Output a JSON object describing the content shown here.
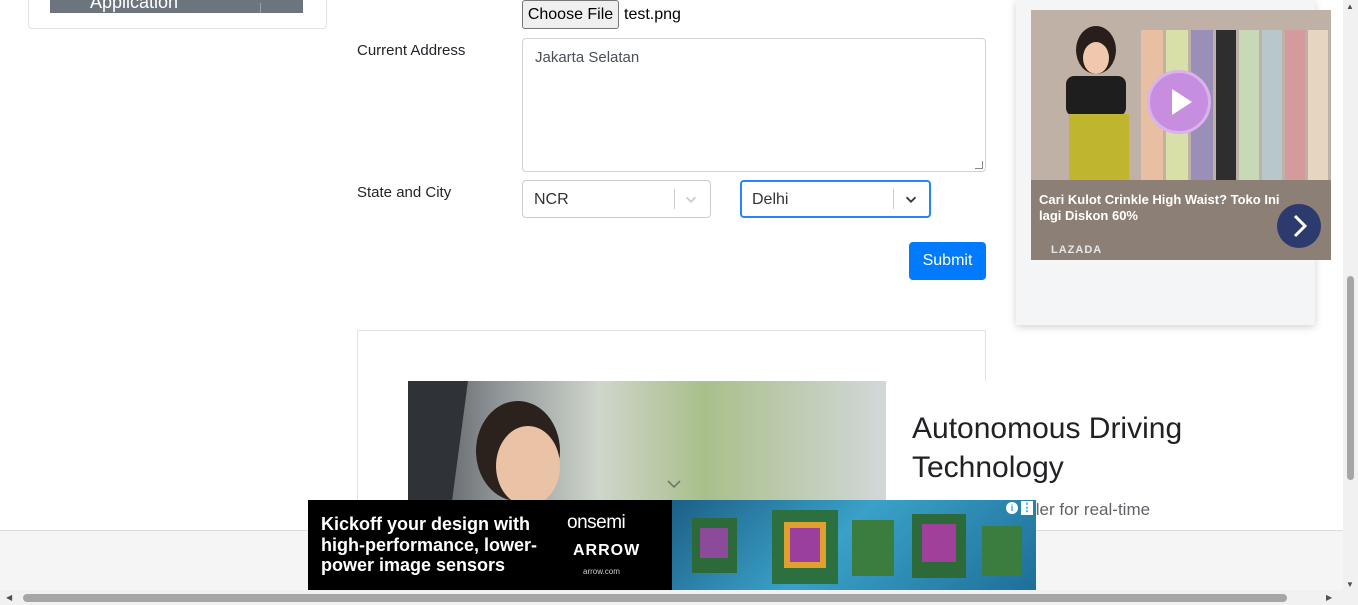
{
  "sidebar": {
    "active_item": "Application"
  },
  "form": {
    "picture": {
      "button_label": "Choose File",
      "file_name": "test.png"
    },
    "current_address": {
      "label": "Current Address",
      "value": "Jakarta Selatan"
    },
    "state_city": {
      "label": "State and City",
      "state": "NCR",
      "city": "Delhi"
    },
    "submit_label": "Submit"
  },
  "ads": {
    "side": {
      "caption": "Cari Kulot Crinkle High Waist? Toko Ini lagi Diskon 60%",
      "brand": "LAZADA"
    },
    "middle": {
      "title": "Autonomous Driving Technology",
      "text": "tive microcontroller for real-time"
    },
    "bottom": {
      "headline": "Kickoff your design with high-performance, lower-power image sensors",
      "logo_1": "onsemi",
      "logo_2": "ARROW",
      "url": "arrow.com"
    }
  },
  "colors": {
    "accent": "#007bff",
    "focus": "#2684ff",
    "sidebar_active": "#6c757d"
  }
}
